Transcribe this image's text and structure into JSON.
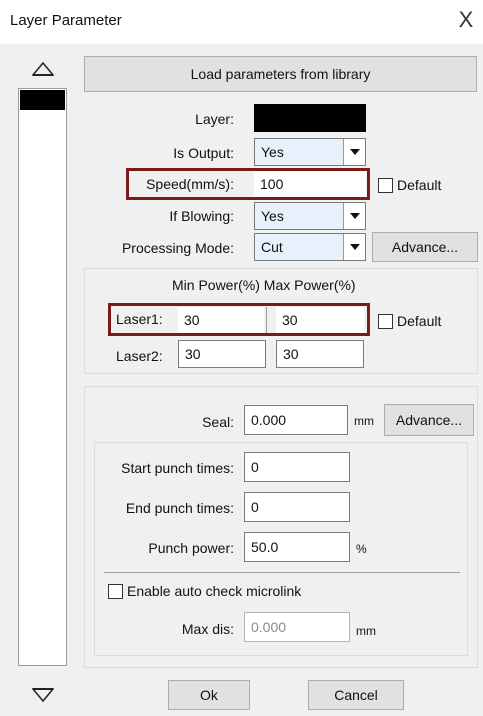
{
  "window": {
    "title": "Layer Parameter",
    "close_label": "X"
  },
  "layer_list": {
    "up_icon": "triangle-up-icon",
    "down_icon": "triangle-down-icon",
    "selected_color": "#000000"
  },
  "library_button": "Load parameters from library",
  "layer_row": {
    "label": "Layer:",
    "color": "#000000"
  },
  "is_output": {
    "label": "Is Output:",
    "value": "Yes"
  },
  "speed": {
    "label": "Speed(mm/s):",
    "value": "100",
    "default_label": "Default"
  },
  "if_blowing": {
    "label": "If Blowing:",
    "value": "Yes"
  },
  "processing_mode": {
    "label": "Processing Mode:",
    "value": "Cut",
    "advance_label": "Advance..."
  },
  "power": {
    "header": "Min Power(%) Max Power(%)",
    "laser1": {
      "label": "Laser1:",
      "min": "30",
      "max": "30"
    },
    "laser2": {
      "label": "Laser2:",
      "min": "30",
      "max": "30"
    },
    "default_label": "Default"
  },
  "seal": {
    "label": "Seal:",
    "value": "0.000",
    "unit": "mm",
    "advance_label": "Advance..."
  },
  "punch": {
    "start_label": "Start punch times:",
    "start_value": "0",
    "end_label": "End punch times:",
    "end_value": "0",
    "power_label": "Punch power:",
    "power_value": "50.0",
    "power_unit": "%"
  },
  "microlink": {
    "enable_label": "Enable auto check microlink",
    "max_dis_label": "Max dis:",
    "max_dis_value": "0.000",
    "max_dis_unit": "mm"
  },
  "footer": {
    "ok_label": "Ok",
    "cancel_label": "Cancel"
  },
  "colors": {
    "highlight_border": "#7a1a1a",
    "combo_bg": "#e7f0fb"
  }
}
